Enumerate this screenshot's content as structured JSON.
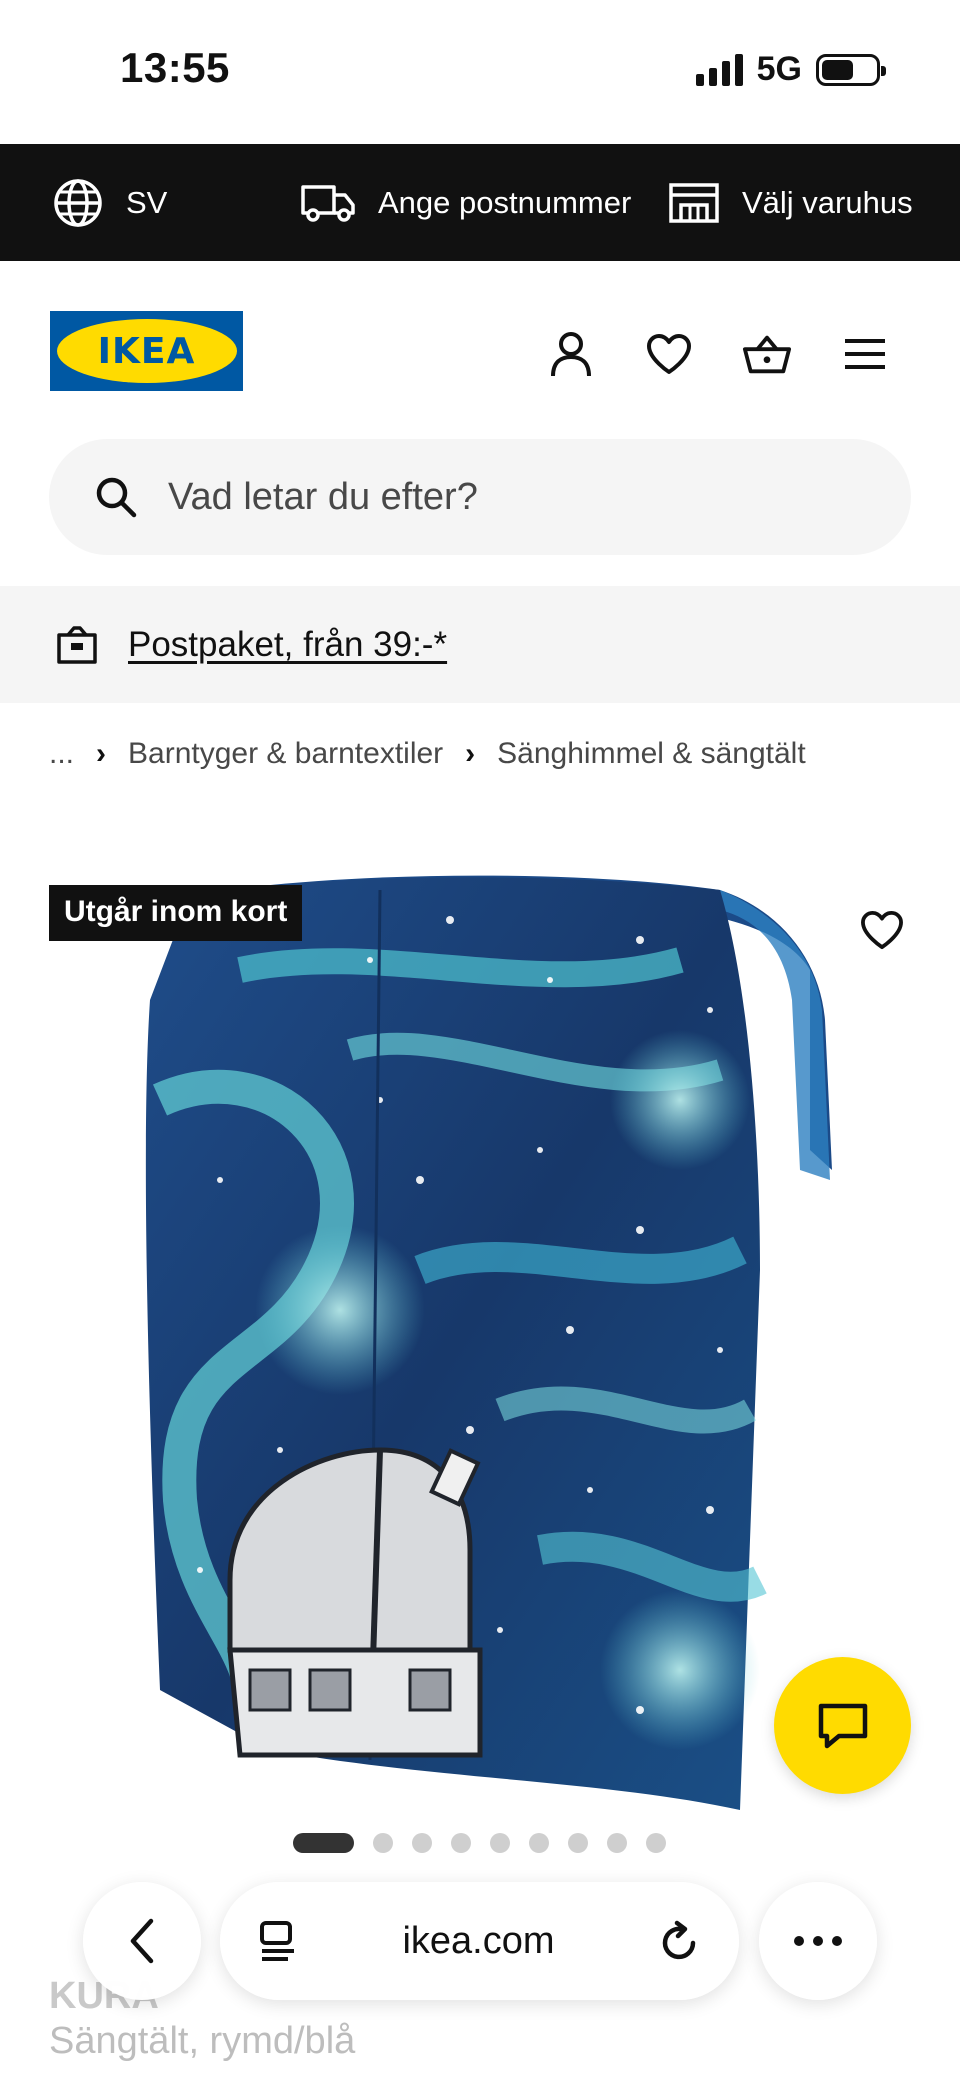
{
  "status_bar": {
    "time": "13:55",
    "network": "5G",
    "battery_level": 0.6
  },
  "top_bar": {
    "language": "SV",
    "postcode_label": "Ange postnummer",
    "store_label": "Välj varuhus",
    "icons": [
      "globe-icon",
      "delivery-truck-icon",
      "store-icon"
    ]
  },
  "header": {
    "logo_text": "IKEA",
    "icons": [
      "user-icon",
      "heart-icon",
      "basket-icon",
      "menu-icon"
    ]
  },
  "search": {
    "placeholder": "Vad letar du efter?"
  },
  "promo": {
    "link_text": "Postpaket, från 39:-*"
  },
  "breadcrumb": {
    "ellipsis": "...",
    "items": [
      "Barntyger & barntextiler",
      "Sänghimmel & sängtält"
    ]
  },
  "product": {
    "badge": "Utgår inom kort",
    "name": "KURA",
    "description": "Sängtält, rymd/blå",
    "image_count": 9,
    "active_image": 1
  },
  "browser": {
    "url": "ikea.com"
  },
  "colors": {
    "brand_blue": "#0058a3",
    "brand_yellow": "#ffdb00",
    "top_bar_bg": "#111111",
    "surface_gray": "#f5f5f5"
  }
}
